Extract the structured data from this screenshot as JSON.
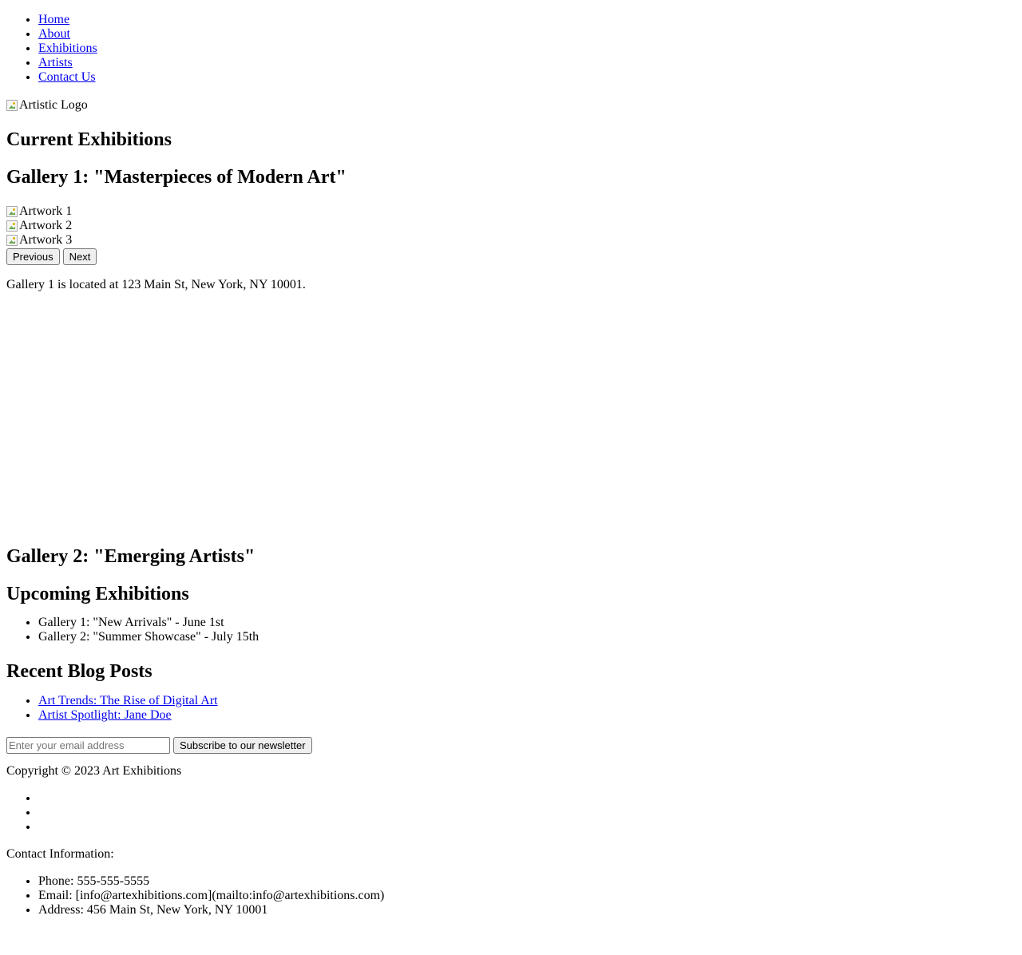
{
  "nav": {
    "items": [
      {
        "label": "Home"
      },
      {
        "label": "About"
      },
      {
        "label": "Exhibitions"
      },
      {
        "label": "Artists"
      },
      {
        "label": "Contact Us"
      }
    ]
  },
  "logo": {
    "alt": "Artistic Logo"
  },
  "current": {
    "heading": "Current Exhibitions",
    "gallery1": {
      "title": "Gallery 1: \"Masterpieces of Modern Art\"",
      "artworks": [
        {
          "alt": "Artwork 1"
        },
        {
          "alt": "Artwork 2"
        },
        {
          "alt": "Artwork 3"
        }
      ],
      "prev_label": "Previous",
      "next_label": "Next",
      "location": "Gallery 1 is located at 123 Main St, New York, NY 10001."
    },
    "gallery2": {
      "title": "Gallery 2: \"Emerging Artists\""
    }
  },
  "upcoming": {
    "heading": "Upcoming Exhibitions",
    "items": [
      {
        "text": "Gallery 1: \"New Arrivals\" - June 1st"
      },
      {
        "text": "Gallery 2: \"Summer Showcase\" - July 15th"
      }
    ]
  },
  "blog": {
    "heading": "Recent Blog Posts",
    "posts": [
      {
        "title": "Art Trends: The Rise of Digital Art"
      },
      {
        "title": "Artist Spotlight: Jane Doe"
      }
    ]
  },
  "newsletter": {
    "placeholder": "Enter your email address",
    "button_label": "Subscribe to our newsletter"
  },
  "footer": {
    "copyright": "Copyright © 2023 Art Exhibitions",
    "contact_label": "Contact Information:",
    "contact_items": [
      {
        "text": "Phone: 555-555-5555"
      },
      {
        "text": "Email: [info@artexhibitions.com](mailto:info@artexhibitions.com)"
      },
      {
        "text": "Address: 456 Main St, New York, NY 10001"
      }
    ]
  },
  "colors": {
    "link": "#0000ee",
    "text": "#000000",
    "background": "#ffffff"
  }
}
